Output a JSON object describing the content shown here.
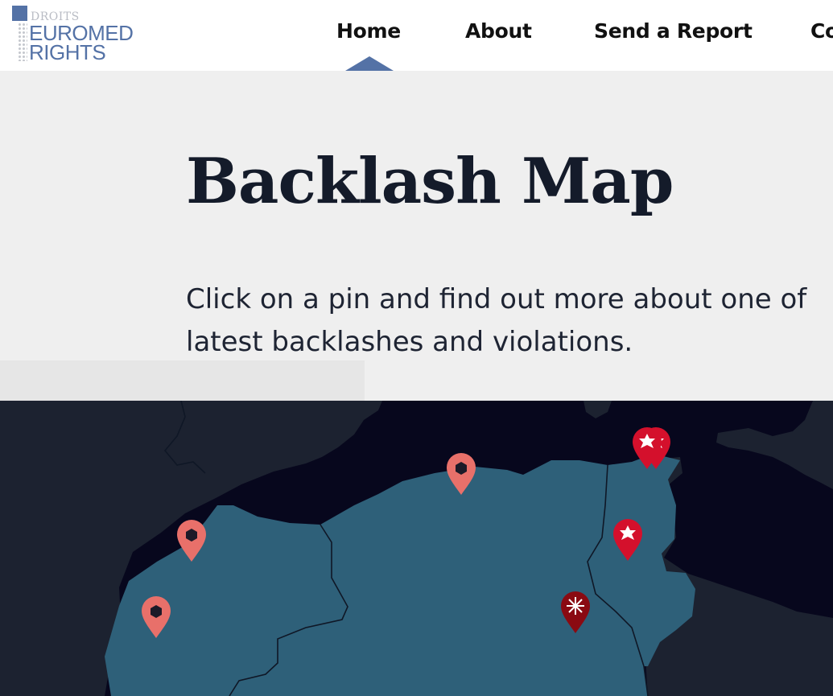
{
  "logo": {
    "line1": "DROITS",
    "line2": "EUROMED",
    "line3": "RIGHTS"
  },
  "nav": {
    "items": [
      {
        "label": "Home",
        "active": true
      },
      {
        "label": "About"
      },
      {
        "label": "Send a Report"
      },
      {
        "label": "Co"
      }
    ]
  },
  "hero": {
    "title": "Backlash Map",
    "intro_line1": "Click on a pin and find out more about one of",
    "intro_line2": "latest backlashes and violations."
  },
  "map": {
    "colors": {
      "sea": "#07071d",
      "land": "#1c2230",
      "highlight": "#2e6079",
      "pin_coral": "#e8706a",
      "pin_red": "#d4102c",
      "pin_dark": "#8a0a12"
    },
    "pins": [
      {
        "icon": "hexagon-icon",
        "color": "pin_coral"
      },
      {
        "icon": "hexagon-icon",
        "color": "pin_coral"
      },
      {
        "icon": "hexagon-icon",
        "color": "pin_coral"
      },
      {
        "icon": "star-icon",
        "color": "pin_red"
      },
      {
        "icon": "star-icon",
        "color": "pin_red"
      },
      {
        "icon": "star-icon",
        "color": "pin_red"
      },
      {
        "icon": "burst-icon",
        "color": "pin_dark"
      }
    ]
  }
}
